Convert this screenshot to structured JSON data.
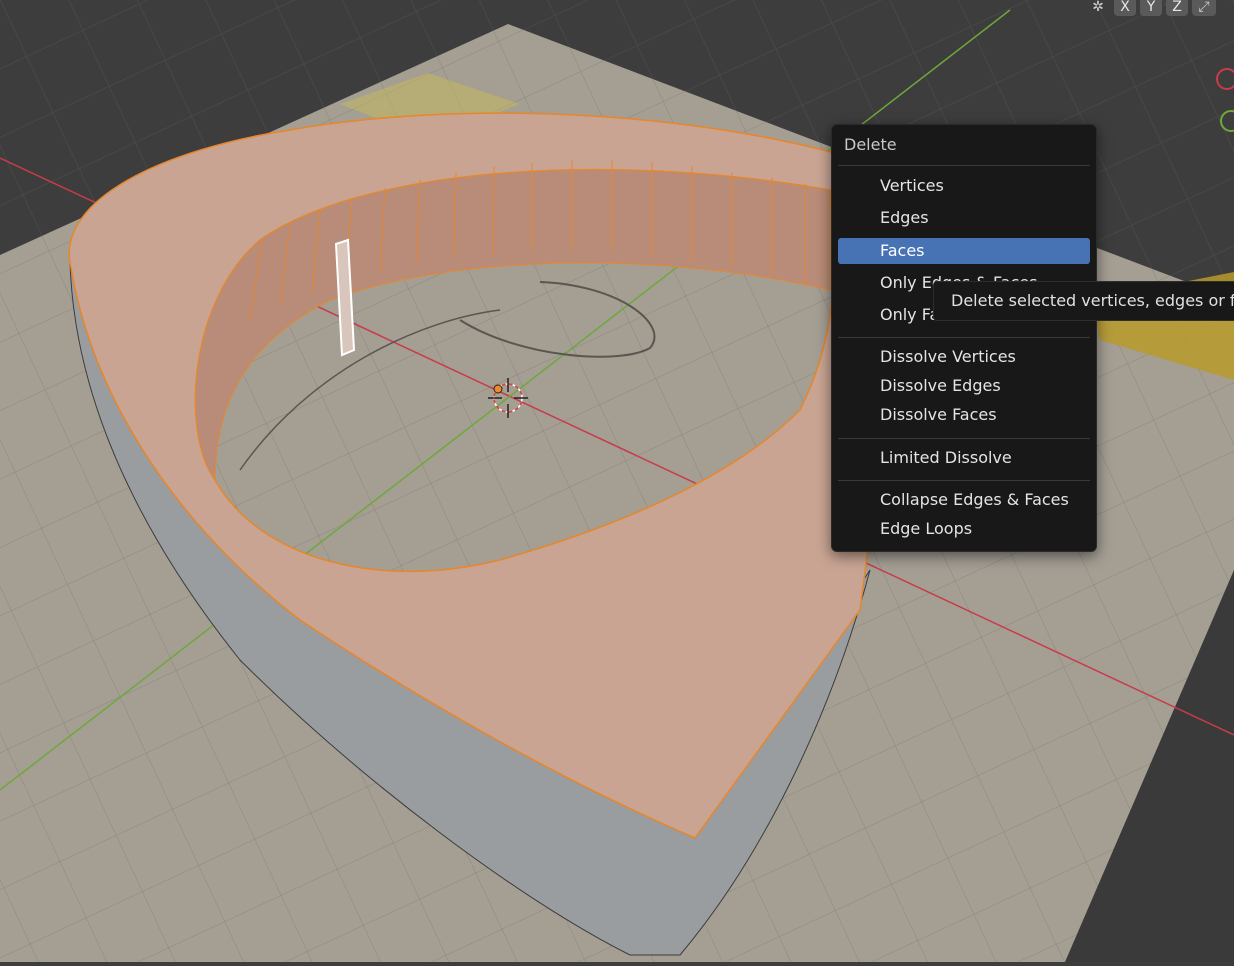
{
  "viewport": {
    "axis_buttons": [
      "X",
      "Y",
      "Z"
    ],
    "icons": [
      "pivot-icon",
      "fullscreen-icon"
    ],
    "colors": {
      "background": "#3d3d3d",
      "floor": "#a49e93",
      "mesh_selected": "#c9a493",
      "edge_selected": "#e8862a",
      "mesh_side": "#9a9da0",
      "x_axis": "#c83c4a",
      "y_axis": "#6ea83a",
      "menu_bg": "#181818",
      "menu_active": "#4772b3"
    }
  },
  "menu": {
    "title": "Delete",
    "items": [
      {
        "label": "Vertices"
      },
      {
        "label": "Edges"
      },
      {
        "label": "Faces",
        "active": true
      },
      {
        "label": "Only Edges & Faces"
      },
      {
        "label": "Only Faces"
      },
      {
        "label": "Dissolve Vertices"
      },
      {
        "label": "Dissolve Edges"
      },
      {
        "label": "Dissolve Faces"
      },
      {
        "label": "Limited Dissolve"
      },
      {
        "label": "Collapse Edges & Faces"
      },
      {
        "label": "Edge Loops"
      }
    ]
  },
  "tooltip": {
    "text": "Delete selected vertices, edges or faces"
  }
}
